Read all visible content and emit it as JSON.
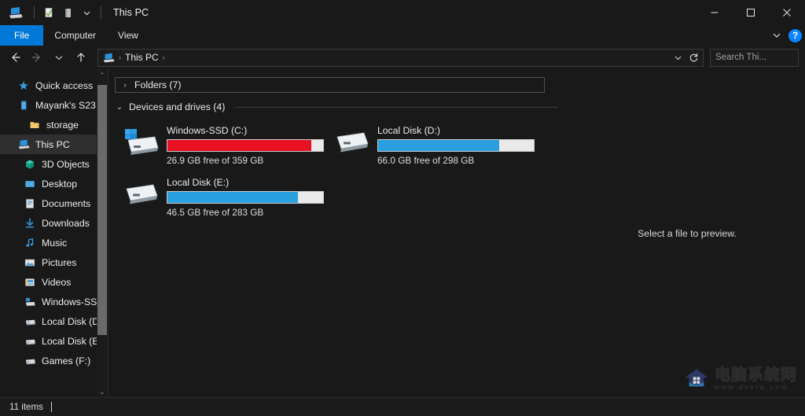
{
  "window": {
    "title": "This PC",
    "app_icon": "this-pc-icon",
    "quick_access": [
      {
        "name": "properties-icon",
        "glyph": "check-document"
      },
      {
        "name": "new-folder-icon",
        "glyph": "folder"
      },
      {
        "name": "customize-quick-access-icon",
        "glyph": "chevron-down"
      }
    ],
    "controls": {
      "minimize": "─",
      "maximize": "❑",
      "close": "✕"
    }
  },
  "ribbon": {
    "tabs": [
      {
        "label": "File",
        "active": true
      },
      {
        "label": "Computer",
        "active": false
      },
      {
        "label": "View",
        "active": false
      }
    ],
    "collapse_icon": "chevron-down-icon",
    "help_label": "?",
    "accent_color": "#0078d7"
  },
  "address_bar": {
    "back_icon": "back-arrow-icon",
    "forward_icon": "forward-arrow-icon",
    "recent_icon": "recent-locations-icon",
    "up_icon": "up-arrow-icon",
    "breadcrumb": {
      "icon": "this-pc-icon",
      "segments": [
        "This PC"
      ],
      "separator": "›"
    },
    "dropdown_icon": "chevron-down-icon",
    "refresh_icon": "refresh-icon"
  },
  "search": {
    "placeholder": "Search Thi...",
    "value": "",
    "icon": "search-icon"
  },
  "sidebar": {
    "items": [
      {
        "label": "Quick access",
        "icon": "star-icon",
        "indent": 0,
        "selected": false
      },
      {
        "label": "Mayank's S23",
        "icon": "phone-icon",
        "indent": 0,
        "selected": false
      },
      {
        "label": "storage",
        "icon": "folder-icon",
        "indent": 1,
        "selected": false
      },
      {
        "label": "This PC",
        "icon": "this-pc-icon",
        "indent": 0,
        "selected": true
      },
      {
        "label": "3D Objects",
        "icon": "3d-objects-icon",
        "indent": 2,
        "selected": false
      },
      {
        "label": "Desktop",
        "icon": "desktop-icon",
        "indent": 2,
        "selected": false
      },
      {
        "label": "Documents",
        "icon": "documents-icon",
        "indent": 2,
        "selected": false
      },
      {
        "label": "Downloads",
        "icon": "downloads-icon",
        "indent": 2,
        "selected": false
      },
      {
        "label": "Music",
        "icon": "music-icon",
        "indent": 2,
        "selected": false
      },
      {
        "label": "Pictures",
        "icon": "pictures-icon",
        "indent": 2,
        "selected": false
      },
      {
        "label": "Videos",
        "icon": "videos-icon",
        "indent": 2,
        "selected": false
      },
      {
        "label": "Windows-SSD",
        "icon": "windows-drive-icon",
        "indent": 2,
        "selected": false
      },
      {
        "label": "Local Disk (D:)",
        "icon": "drive-icon",
        "indent": 2,
        "selected": false
      },
      {
        "label": "Local Disk (E:)",
        "icon": "drive-icon",
        "indent": 2,
        "selected": false
      },
      {
        "label": "Games (F:)",
        "icon": "drive-icon",
        "indent": 2,
        "selected": false
      }
    ],
    "scrollbar": {
      "up_arrow": "⌃",
      "down_arrow": "⌄"
    }
  },
  "content": {
    "groups": [
      {
        "name": "folders",
        "title": "Folders (7)",
        "expanded": false,
        "chevron": "›",
        "boxed": true
      },
      {
        "name": "devices-and-drives",
        "title": "Devices and drives (4)",
        "expanded": true,
        "chevron": "⌄",
        "boxed": false
      }
    ],
    "drives": [
      {
        "name": "Windows-SSD (C:)",
        "free_text": "26.9 GB free of 359 GB",
        "free_gb": 26.9,
        "total_gb": 359,
        "used_percent": 92.5,
        "bar_color": "#e81123",
        "icon": "windows-drive-icon",
        "low_space": true
      },
      {
        "name": "Local Disk (D:)",
        "free_text": "66.0 GB free of 298 GB",
        "free_gb": 66.0,
        "total_gb": 298,
        "used_percent": 77.9,
        "bar_color": "#2a9fe0",
        "icon": "drive-icon",
        "low_space": false
      },
      {
        "name": "Local Disk (E:)",
        "free_text": "46.5 GB free of 283 GB",
        "free_gb": 46.5,
        "total_gb": 283,
        "used_percent": 83.6,
        "bar_color": "#2a9fe0",
        "icon": "drive-icon",
        "low_space": false
      }
    ]
  },
  "preview": {
    "message": "Select a file to preview."
  },
  "watermark": {
    "title": "电脑系统网",
    "url": "www.dnxtw.com",
    "logo": "house-logo"
  },
  "statusbar": {
    "item_count": "11 items"
  }
}
